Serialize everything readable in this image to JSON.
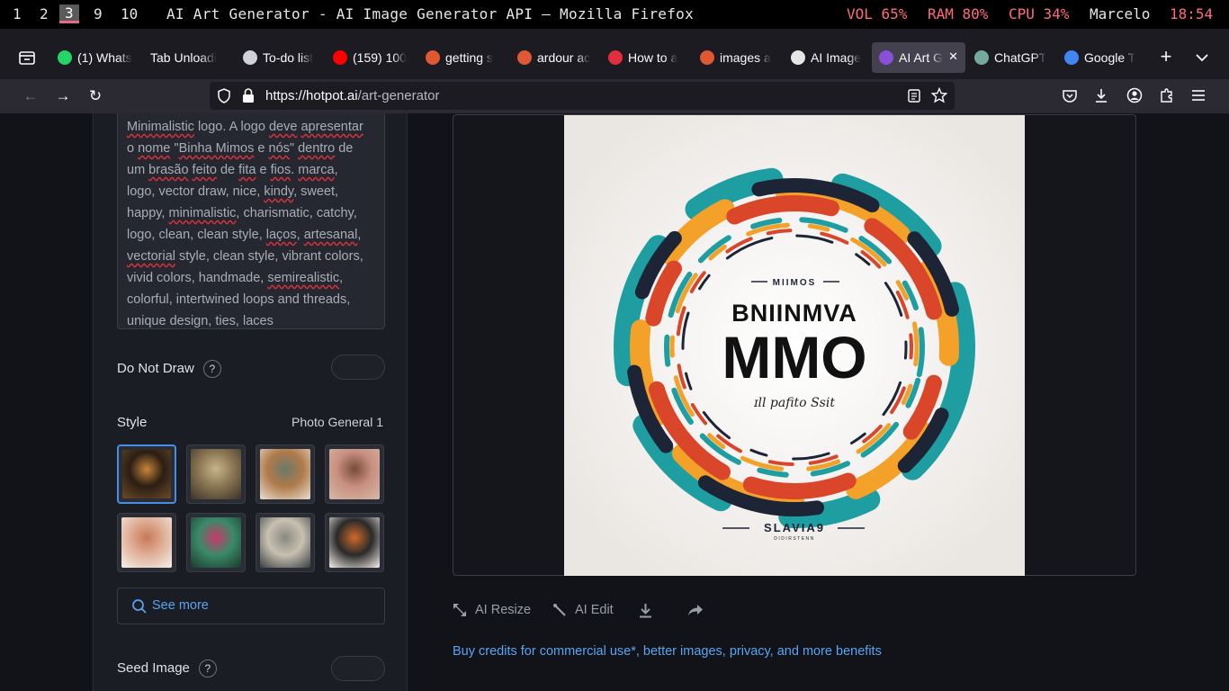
{
  "system_bar": {
    "workspaces": [
      "1",
      "2",
      "3",
      "9",
      "10"
    ],
    "active_workspace": "3",
    "window_title": "AI Art Generator - AI Image Generator API — Mozilla Firefox",
    "vol": "VOL 65%",
    "ram": "RAM 80%",
    "cpu": "CPU 34%",
    "user": "Marcelo",
    "clock": "18:54"
  },
  "tabs": [
    {
      "label": "(1) Whats",
      "icon": "whatsapp-icon",
      "color": "#25d366"
    },
    {
      "label": "Tab Unloadi",
      "icon": "none",
      "color": ""
    },
    {
      "label": "To-do list",
      "icon": "anchor-icon",
      "color": "#cfd2d8"
    },
    {
      "label": "(159) 100",
      "icon": "youtube-icon",
      "color": "#ff0000"
    },
    {
      "label": "getting s",
      "icon": "duckduckgo-icon",
      "color": "#de5833"
    },
    {
      "label": "ardour ac",
      "icon": "duckduckgo-icon",
      "color": "#de5833"
    },
    {
      "label": "How to a",
      "icon": "arch-icon",
      "color": "#e03040"
    },
    {
      "label": "images a",
      "icon": "duckduckgo-icon",
      "color": "#de5833"
    },
    {
      "label": "AI Image",
      "icon": "sync-icon",
      "color": "#e6e6e6"
    },
    {
      "label": "AI Art G",
      "icon": "hotpot-icon",
      "color": "#8a4fd8",
      "active": true
    },
    {
      "label": "ChatGPT",
      "icon": "chatgpt-icon",
      "color": "#74aa9c"
    },
    {
      "label": "Google T",
      "icon": "google-translate-icon",
      "color": "#4285f4"
    }
  ],
  "navbar": {
    "url_host": "https://hotpot.ai",
    "url_path": "/art-generator"
  },
  "prompt": {
    "lines": [
      [
        {
          "t": "Minimalistic",
          "s": true
        },
        {
          "t": " logo. A logo ",
          "s": false
        },
        {
          "t": "deve",
          "s": true
        },
        {
          "t": " ",
          "s": false
        },
        {
          "t": "apresentar",
          "s": true
        }
      ],
      [
        {
          "t": "o ",
          "s": false
        },
        {
          "t": "nome",
          "s": true
        },
        {
          "t": " \"",
          "s": false
        },
        {
          "t": "Binha Mimos",
          "s": true
        },
        {
          "t": " e ",
          "s": false
        },
        {
          "t": "nós",
          "s": true
        },
        {
          "t": "\" ",
          "s": false
        },
        {
          "t": "dentro",
          "s": true
        },
        {
          "t": " de",
          "s": false
        }
      ],
      [
        {
          "t": "um ",
          "s": false
        },
        {
          "t": "brasão",
          "s": true
        },
        {
          "t": " ",
          "s": false
        },
        {
          "t": "feito",
          "s": true
        },
        {
          "t": " de ",
          "s": false
        },
        {
          "t": "fita",
          "s": true
        },
        {
          "t": " e ",
          "s": false
        },
        {
          "t": "fios",
          "s": true
        },
        {
          "t": ". ",
          "s": false
        },
        {
          "t": "marca",
          "s": true
        },
        {
          "t": ",",
          "s": false
        }
      ],
      [
        {
          "t": "logo, vector draw, nice, ",
          "s": false
        },
        {
          "t": "kindy",
          "s": true
        },
        {
          "t": ", sweet,",
          "s": false
        }
      ],
      [
        {
          "t": "happy, ",
          "s": false
        },
        {
          "t": "minimalistic",
          "s": true
        },
        {
          "t": ", charismatic, catchy,",
          "s": false
        }
      ],
      [
        {
          "t": "logo, clean, clean style, ",
          "s": false
        },
        {
          "t": "laços",
          "s": true
        },
        {
          "t": ", ",
          "s": false
        },
        {
          "t": "artesanal",
          "s": true
        },
        {
          "t": ",",
          "s": false
        }
      ],
      [
        {
          "t": "vectorial",
          "s": true
        },
        {
          "t": " style, clean style, vibrant colors,",
          "s": false
        }
      ],
      [
        {
          "t": "vivid colors, handmade, ",
          "s": false
        },
        {
          "t": "semirealistic",
          "s": true
        },
        {
          "t": ",",
          "s": false
        }
      ],
      [
        {
          "t": "colorful, intertwined loops and threads,",
          "s": false
        }
      ],
      [
        {
          "t": "unique design, ties, laces",
          "s": false
        }
      ]
    ]
  },
  "do_not_draw": {
    "label": "Do Not Draw",
    "help": "?"
  },
  "style": {
    "label": "Style",
    "selected": "Photo General 1"
  },
  "style_thumbs": [
    {
      "name": "style-tiger",
      "colors": [
        "#6b4a2a",
        "#c9853a",
        "#2b1e14"
      ]
    },
    {
      "name": "style-robot-bull",
      "colors": [
        "#3a3328",
        "#c8b48a",
        "#8a7652"
      ]
    },
    {
      "name": "style-violinist",
      "colors": [
        "#e8e0d0",
        "#6a7a6a",
        "#b07a4a"
      ]
    },
    {
      "name": "style-anime-girl",
      "colors": [
        "#d6b8a8",
        "#7a4a3a",
        "#c89080"
      ]
    },
    {
      "name": "style-glass-figure",
      "colors": [
        "#f4f0ec",
        "#c87858",
        "#e0b098"
      ]
    },
    {
      "name": "style-cyber-woman",
      "colors": [
        "#1a3a2a",
        "#c83a6a",
        "#3a8a6a"
      ]
    },
    {
      "name": "style-old-man",
      "colors": [
        "#3a3f44",
        "#8a8a82",
        "#c8c0b0"
      ]
    },
    {
      "name": "style-fox-logo",
      "colors": [
        "#f6f0e8",
        "#d06a2a",
        "#2a2a2a"
      ]
    }
  ],
  "see_more": {
    "label": "See more"
  },
  "seed_image": {
    "label": "Seed Image",
    "help": "?"
  },
  "artwork": {
    "top_text": "MIIMOS",
    "line1": "BNIINMVA",
    "line2": "MMO",
    "script": "ɪll pafito Ssit",
    "bottom": "SLAVIA9",
    "bottom_small": "DIDIRSTENN"
  },
  "actions": {
    "resize": "AI Resize",
    "edit": "AI Edit"
  },
  "buy_link": "Buy credits for commercial use*, better images, privacy, and more benefits",
  "colors": {
    "accent": "#5aa4f0",
    "clock": "#ff6b7d",
    "art_teal": "#1e9ea0",
    "art_orange": "#f4a12a",
    "art_red": "#d9462a",
    "art_navy": "#1c2436"
  }
}
